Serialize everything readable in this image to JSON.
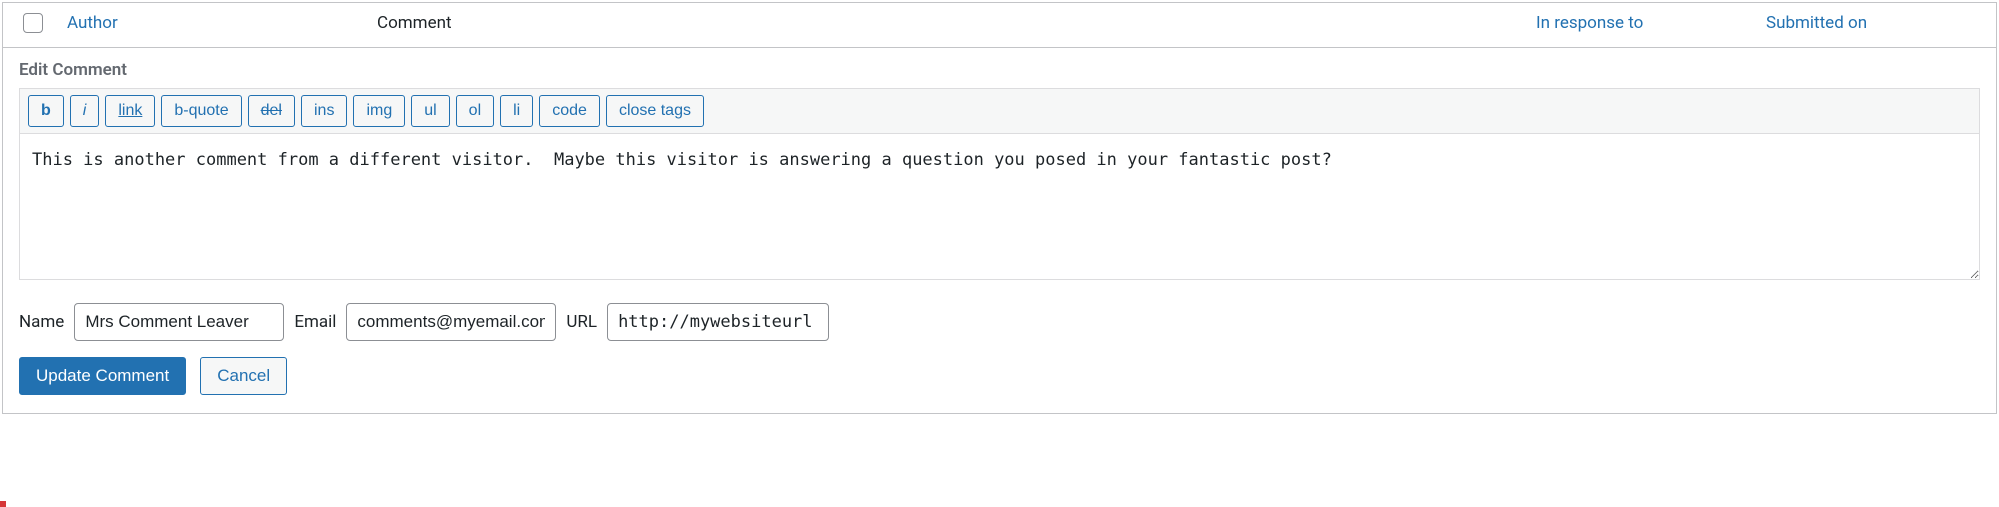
{
  "columns": {
    "author": "Author",
    "comment": "Comment",
    "response": "In response to",
    "submitted": "Submitted on"
  },
  "edit": {
    "label": "Edit Comment",
    "toolbar": [
      {
        "label": "b",
        "cls": "bold"
      },
      {
        "label": "i",
        "cls": "italic"
      },
      {
        "label": "link",
        "cls": "link-b"
      },
      {
        "label": "b-quote",
        "cls": ""
      },
      {
        "label": "del",
        "cls": "del-b"
      },
      {
        "label": "ins",
        "cls": ""
      },
      {
        "label": "img",
        "cls": ""
      },
      {
        "label": "ul",
        "cls": ""
      },
      {
        "label": "ol",
        "cls": ""
      },
      {
        "label": "li",
        "cls": ""
      },
      {
        "label": "code",
        "cls": ""
      },
      {
        "label": "close tags",
        "cls": ""
      }
    ],
    "content": "This is another comment from a different visitor.  Maybe this visitor is answering a question you posed in your fantastic post?",
    "fields": {
      "name": {
        "label": "Name",
        "value": "Mrs Comment Leaver"
      },
      "email": {
        "label": "Email",
        "value": "comments@myemail.com"
      },
      "url": {
        "label": "URL",
        "value": "http://mywebsiteurl"
      }
    },
    "actions": {
      "update": "Update Comment",
      "cancel": "Cancel"
    }
  }
}
